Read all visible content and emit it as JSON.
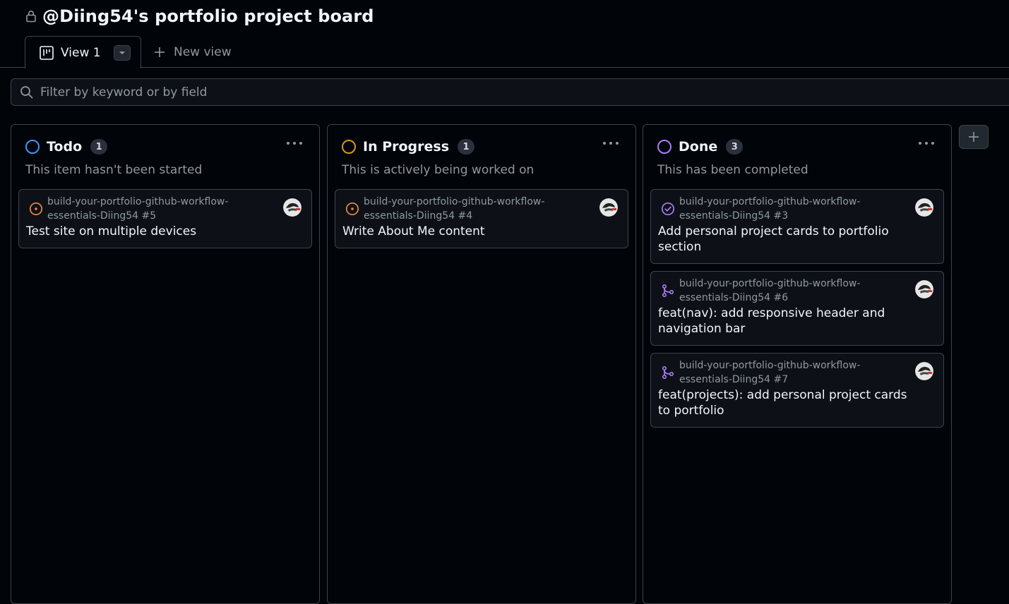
{
  "header": {
    "title": "@Diing54's portfolio project board",
    "lock_icon": "lock-icon"
  },
  "tabs": {
    "active_label": "View 1",
    "new_view_label": "New view"
  },
  "filter": {
    "placeholder": "Filter by keyword or by field"
  },
  "colors": {
    "todo": "#4493f8",
    "in_progress": "#d29922",
    "done": "#ab7df8",
    "open_issue": "#f0883e",
    "closed_issue": "#ab7df8",
    "merged_pr": "#ab7df8"
  },
  "columns": [
    {
      "title": "Todo",
      "count": "1",
      "description": "This item hasn't been started",
      "cards": [
        {
          "repo": "build-your-portfolio-github-workflow-essentials-Diing54 #5",
          "title": "Test site on multiple devices",
          "icon": "open-issue-icon"
        }
      ]
    },
    {
      "title": "In Progress",
      "count": "1",
      "description": "This is actively being worked on",
      "cards": [
        {
          "repo": "build-your-portfolio-github-workflow-essentials-Diing54 #4",
          "title": "Write About Me content",
          "icon": "open-issue-icon"
        }
      ]
    },
    {
      "title": "Done",
      "count": "3",
      "description": "This has been completed",
      "cards": [
        {
          "repo": "build-your-portfolio-github-workflow-essentials-Diing54 #3",
          "title": "Add personal project cards to portfolio section",
          "icon": "closed-issue-icon"
        },
        {
          "repo": "build-your-portfolio-github-workflow-essentials-Diing54 #6",
          "title": "feat(nav): add responsive header and navigation bar",
          "icon": "merged-pr-icon"
        },
        {
          "repo": "build-your-portfolio-github-workflow-essentials-Diing54 #7",
          "title": "feat(projects): add personal project cards to portfolio",
          "icon": "merged-pr-icon"
        }
      ]
    }
  ]
}
